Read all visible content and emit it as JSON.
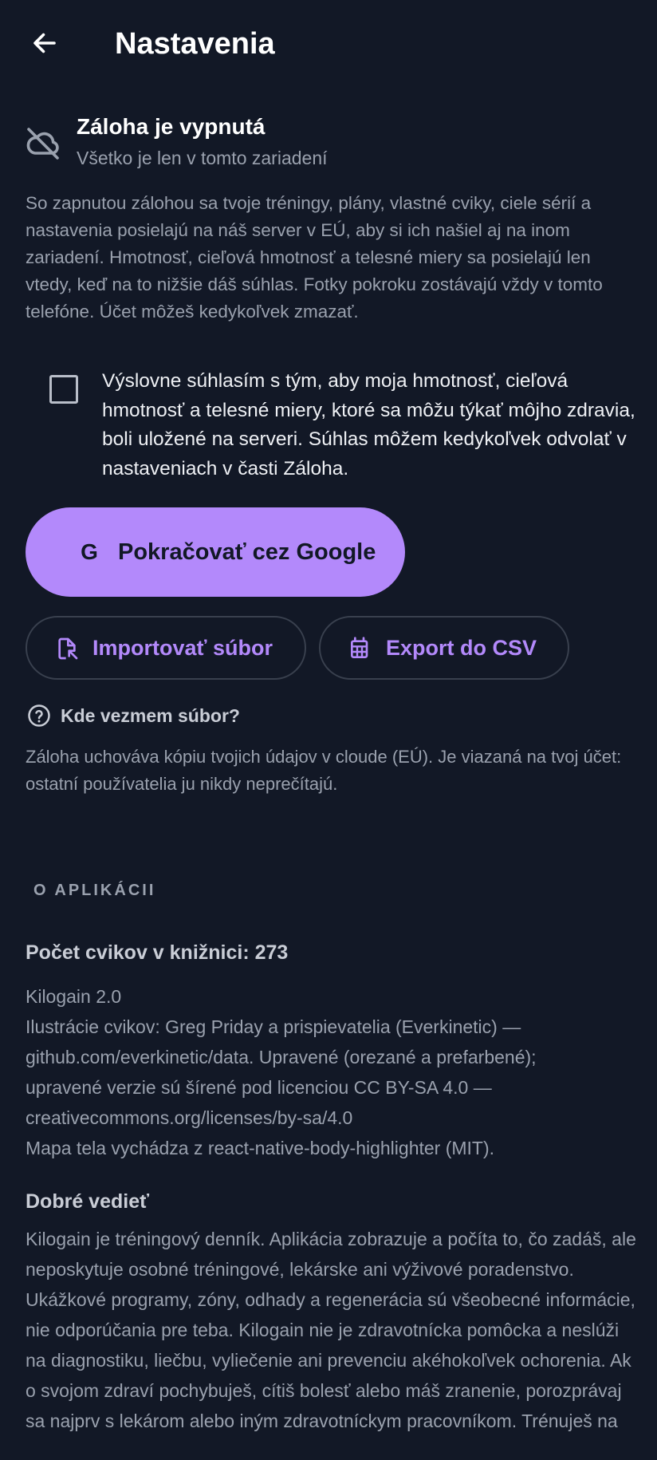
{
  "header": {
    "title": "Nastavenia",
    "back_icon": "arrow-left-icon"
  },
  "backup": {
    "status_title": "Záloha je vypnutá",
    "status_subtitle": "Všetko je len v tomto zariadení",
    "status_icon": "cloud-off-icon",
    "description": "So zapnutou zálohou sa tvoje tréningy, plány, vlastné cviky, ciele sérií a nastavenia posielajú na náš server v EÚ, aby si ich našiel aj na inom zariadení. Hmotnosť, cieľová hmotnosť a telesné miery sa posielajú len vtedy, keď na to nižšie dáš súhlas. Fotky pokroku zostávajú vždy v tomto telefóne. Účet môžeš kedykoľvek zmazať.",
    "consent_checked": false,
    "consent_text": "Výslovne súhlasím s tým, aby moja hmotnosť, cieľová hmotnosť a telesné miery, ktoré sa môžu týkať môjho zdravia, boli uložené na serveri. Súhlas môžem kedykoľvek odvolať v nastaveniach v časti Záloha.",
    "google_button": {
      "label": "Pokračovať cez Google",
      "icon_glyph": "G"
    },
    "import_button": {
      "label": "Importovať súbor",
      "icon": "file-import-icon"
    },
    "export_button": {
      "label": "Export do CSV",
      "icon": "spreadsheet-icon"
    },
    "help_link": {
      "label": "Kde vezmem súbor?",
      "icon": "help-circle-icon"
    },
    "cloud_note": "Záloha uchováva kópiu tvojich údajov v cloude (EÚ). Je viazaná na tvoj účet: ostatní používatelia ju nikdy neprečítajú."
  },
  "about": {
    "section_header": "O APLIKÁCII",
    "exercise_count": "Počet cvikov v knižnici: 273",
    "info_lines": [
      "Kilogain 2.0",
      "Ilustrácie cvikov: Greg Priday a prispievatelia (Everkinetic) —",
      "github.com/everkinetic/data. Upravené (orezané a prefarbené);",
      "upravené verzie sú šírené pod licenciou CC BY-SA 4.0 —",
      "creativecommons.org/licenses/by-sa/4.0",
      "Mapa tela vychádza z react-native-body-highlighter (MIT)."
    ],
    "good_to_know_title": "Dobré vedieť",
    "good_to_know_text": "Kilogain je tréningový denník. Aplikácia zobrazuje a počíta to, čo zadáš, ale neposkytuje osobné tréningové, lekárske ani výživové poradenstvo. Ukážkové programy, zóny, odhady a regenerácia sú všeobecné informácie, nie odporúčania pre teba. Kilogain nie je zdravotnícka pomôcka a neslúži na diagnostiku, liečbu, vyliečenie ani prevenciu akéhokoľvek ochorenia. Ak o svojom zdraví pochybuješ, cítiš bolesť alebo máš zranenie, porozprávaj sa najprv s lekárom alebo iným zdravotníckym pracovníkom. Trénuješ na"
  },
  "colors": {
    "background": "#121826",
    "accent": "#b389fb",
    "text_primary": "#ffffff",
    "text_secondary": "#9aa1ae",
    "outline": "#39404e"
  }
}
